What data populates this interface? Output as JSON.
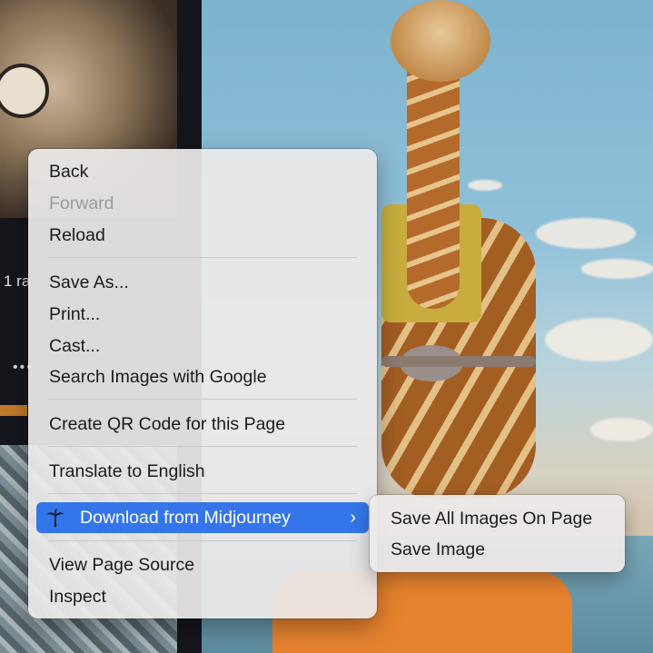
{
  "background": {
    "left_text": "1 ra",
    "left_dots": "•••"
  },
  "context_menu": {
    "items": [
      {
        "label": "Back",
        "enabled": true
      },
      {
        "label": "Forward",
        "enabled": false
      },
      {
        "label": "Reload",
        "enabled": true
      },
      {
        "label": "Save As...",
        "enabled": true
      },
      {
        "label": "Print...",
        "enabled": true
      },
      {
        "label": "Cast...",
        "enabled": true
      },
      {
        "label": "Search Images with Google",
        "enabled": true
      },
      {
        "label": "Create QR Code for this Page",
        "enabled": true
      },
      {
        "label": "Translate to English",
        "enabled": true
      },
      {
        "label": "Download from Midjourney",
        "enabled": true,
        "icon": "palm-tree-icon",
        "has_submenu": true,
        "highlighted": true
      },
      {
        "label": "View Page Source",
        "enabled": true
      },
      {
        "label": "Inspect",
        "enabled": true
      }
    ],
    "highlight_color": "#3476e9",
    "chevron": "›"
  },
  "submenu": {
    "items": [
      {
        "label": "Save All Images On Page"
      },
      {
        "label": "Save Image"
      }
    ]
  }
}
